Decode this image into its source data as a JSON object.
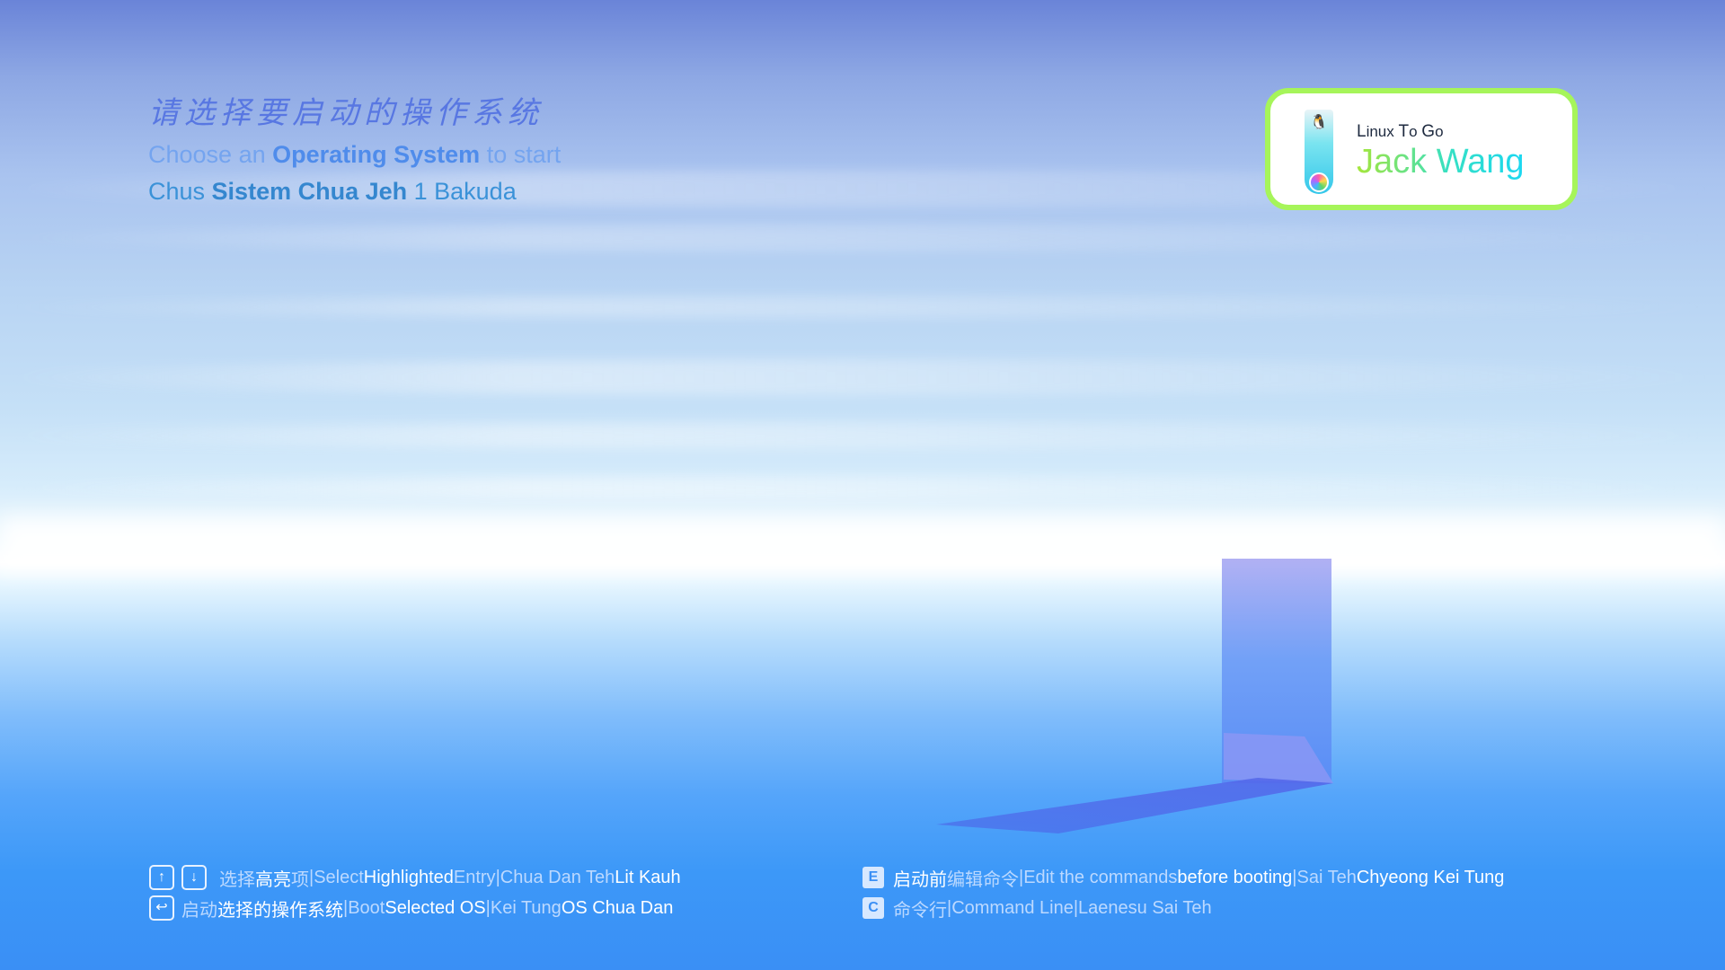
{
  "header": {
    "title_cn": "请选择要启动的操作系统",
    "title_en_pre": "Choose an ",
    "title_en_bold": "Operating System",
    "title_en_post": " to start",
    "title_mien_pre": "Chus ",
    "title_mien_bold": "Sistem Chua Jeh",
    "title_mien_post": " 1 Bakuda"
  },
  "badge": {
    "subtitle_l": "L",
    "subtitle_1": "inux ",
    "subtitle_t": "T",
    "subtitle_2": "o ",
    "subtitle_g": "G",
    "subtitle_3": "o",
    "name": "Jack Wang",
    "usb_icon": "usb-drive-icon",
    "tux_icon": "tux-penguin-icon",
    "border_color": "#a6f55a"
  },
  "hints_left": [
    {
      "keys": [
        "↑",
        "↓"
      ],
      "cn_dim": "选择",
      "cn_bright": "高亮",
      "cn_dim2": "项",
      "sep1": " | ",
      "en_dim": "Select ",
      "en_bright": "Highlighted",
      "en_dim2": " Entry",
      "sep2": " | ",
      "m_dim": "Chua Dan Teh ",
      "m_bright": "Lit Kauh"
    },
    {
      "keys": [
        "↩"
      ],
      "cn_dim": "启动",
      "cn_bright": "选择的操作系统",
      "sep1": " | ",
      "en_dim": "Boot ",
      "en_bright": "Selected OS",
      "sep2": " | ",
      "m_dim": "Kei Tung ",
      "m_bright": "OS Chua Dan"
    }
  ],
  "hints_right": [
    {
      "key": "E",
      "cn_bright": "启动前",
      "cn_dim": "编辑命令",
      "sep1": " | ",
      "en_dim": "Edit the commands ",
      "en_bright": "before booting",
      "sep2": " | ",
      "m_dim": "Sai Teh ",
      "m_bright": "Chyeong Kei Tung"
    },
    {
      "key": "C",
      "cn_dim": "命令行",
      "sep1": " | ",
      "en_dim": "Command Line",
      "sep2": " | ",
      "m_dim": "Laenesu Sai Teh"
    }
  ]
}
